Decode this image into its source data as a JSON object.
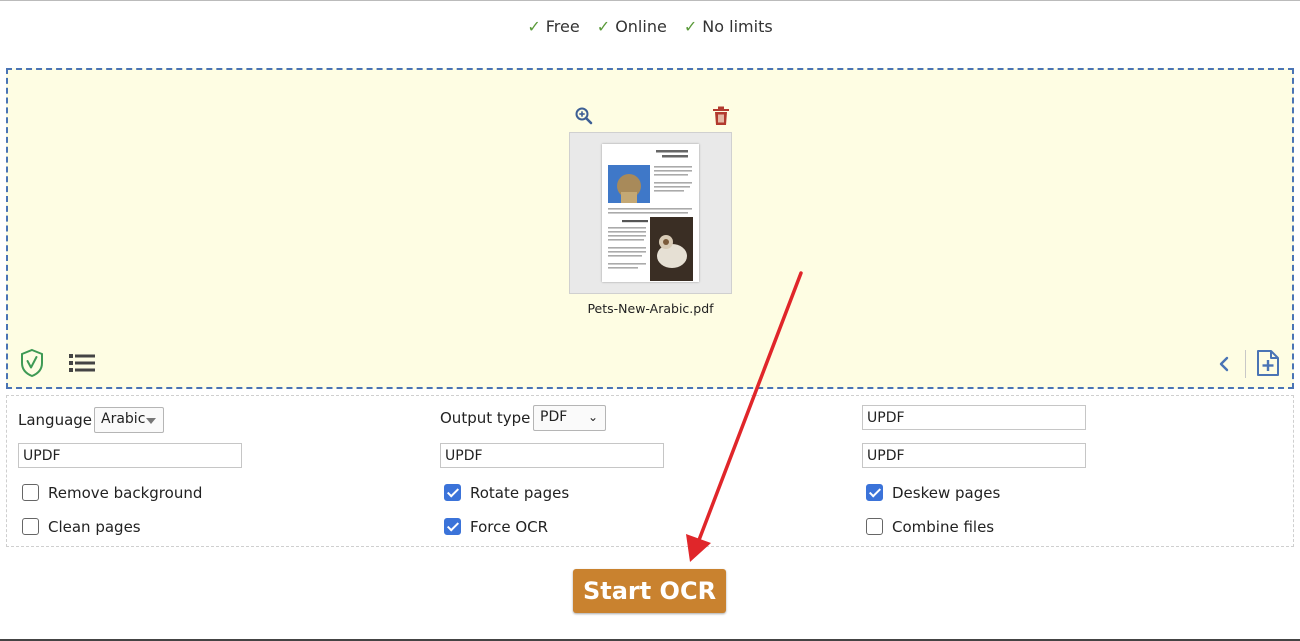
{
  "features": [
    {
      "check": "✓",
      "label": "Free"
    },
    {
      "check": "✓",
      "label": "Online"
    },
    {
      "check": "✓",
      "label": "No limits"
    }
  ],
  "dropzone": {
    "file_name": "Pets-New-Arabic.pdf",
    "icons": [
      "zoom-in-icon",
      "trash-icon",
      "shield-check-icon",
      "list-icon",
      "chevron-left-icon",
      "add-file-icon"
    ]
  },
  "options": {
    "language_label": "Language",
    "language_value": "Arabic",
    "output_type_label": "Output type",
    "output_type_value": "PDF",
    "text_fields": [
      "UPDF",
      "UPDF",
      "UPDF",
      "UPDF"
    ],
    "checkboxes": [
      {
        "label": "Remove background",
        "checked": false
      },
      {
        "label": "Clean pages",
        "checked": false
      },
      {
        "label": "Rotate pages",
        "checked": true
      },
      {
        "label": "Force OCR",
        "checked": true
      },
      {
        "label": "Deskew pages",
        "checked": true
      },
      {
        "label": "Combine files",
        "checked": false
      }
    ]
  },
  "start_button": "Start OCR",
  "colors": {
    "dropzone_bg": "#fefde3",
    "dropzone_border": "#4a74b5",
    "start_button": "#c9822f",
    "checkbox_checked": "#3b73d9",
    "annotation_arrow": "#e0262a"
  }
}
